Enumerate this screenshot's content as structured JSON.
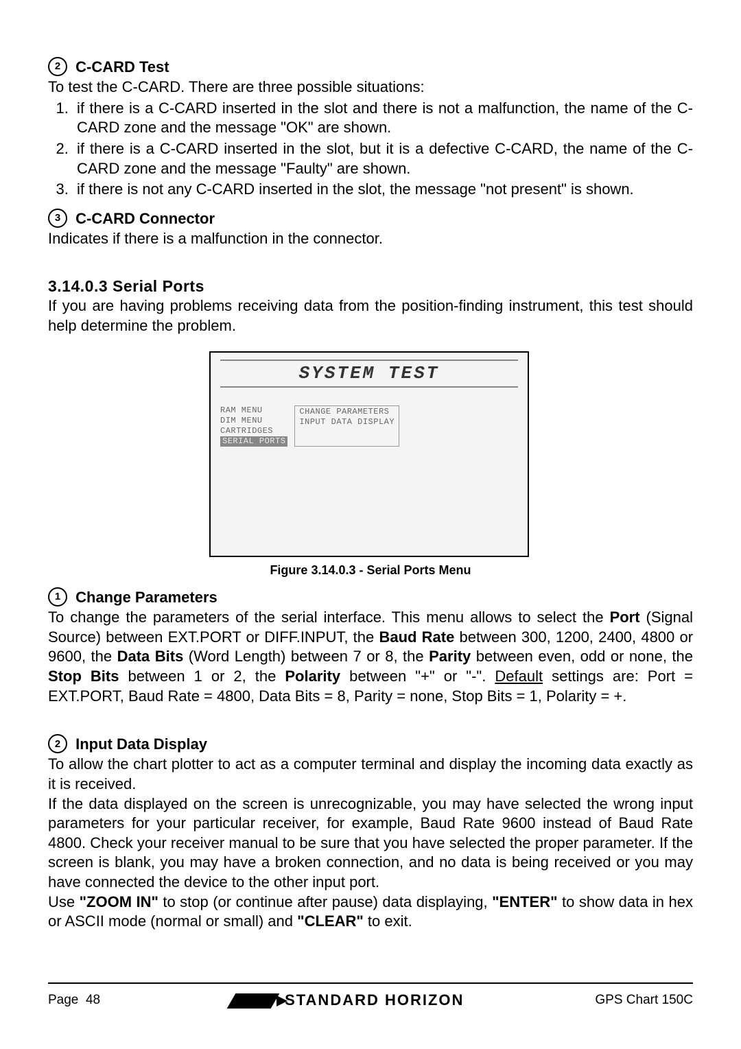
{
  "section2": {
    "num": "2",
    "title": "C-CARD Test",
    "intro": "To test the C-CARD. There are three possible situations:",
    "items": [
      "if there is a C-CARD inserted in the slot and there is not a malfunction, the name of the C-CARD zone and the message \"OK\" are shown.",
      "if there is a C-CARD inserted in the slot, but it is a defective C-CARD, the name of the C-CARD zone and the message \"Faulty\" are shown.",
      "if there is not any C-CARD inserted in the slot, the message \"not present\" is shown."
    ]
  },
  "section3": {
    "num": "3",
    "title": "C-CARD Connector",
    "text": "Indicates if there is a malfunction in the connector."
  },
  "serial": {
    "heading_num": "3.14.0.3",
    "heading_title": "Serial Ports",
    "intro": "If you are having problems receiving data from the position-finding instrument, this test should help determine the problem.",
    "screen_title": "SYSTEM TEST",
    "menu_left": [
      "RAM MENU",
      "DIM MENU",
      "CARTRIDGES",
      "SERIAL PORTS"
    ],
    "menu_right": [
      "CHANGE PARAMETERS",
      "INPUT DATA DISPLAY"
    ],
    "fig_caption": "Figure 3.14.0.3 - Serial Ports Menu"
  },
  "change_params": {
    "num": "1",
    "title": "Change Parameters",
    "p1_a": "To change the parameters of the serial interface. This menu allows to select the ",
    "b_port": "Port",
    "p1_b": " (Signal Source) between EXT.PORT or DIFF.INPUT, the ",
    "b_baud": "Baud Rate",
    "p1_c": " between 300, 1200, 2400, 4800 or 9600, the ",
    "b_data": "Data Bits",
    "p1_d": " (Word Length) between 7 or 8, the ",
    "b_parity": "Parity",
    "p1_e": " between even, odd or none, the ",
    "b_stop": "Stop Bits",
    "p1_f": " between 1 or 2, the ",
    "b_polarity": "Polarity",
    "p1_g": " between \"+\" or \"-\". ",
    "u_default": "Default",
    "p1_h": " settings are: Port = EXT.PORT, Baud Rate = 4800, Data Bits = 8, Parity = none, Stop Bits = 1, Polarity = +."
  },
  "input_disp": {
    "num": "2",
    "title": "Input Data Display",
    "p1": "To allow the chart plotter to act as a computer terminal and display the incoming data exactly as it is received.",
    "p2": "If the data displayed on the screen is unrecognizable, you may have selected the wrong input parameters for your particular receiver, for example, Baud Rate 9600 instead of Baud Rate 4800. Check your receiver manual to be sure that you have selected the proper parameter. If the screen is blank, you may have a broken connection, and no data is being received or you may have connected the device to the other input port.",
    "p3_a": "Use ",
    "b_zoom": "\"ZOOM IN\"",
    "p3_b": " to stop (or continue after pause) data displaying, ",
    "b_enter": "\"ENTER\"",
    "p3_c": " to show data in hex or ASCII mode (normal or small) and ",
    "b_clear": "\"CLEAR\"",
    "p3_d": " to exit."
  },
  "footer": {
    "page_label": "Page",
    "page_num": "48",
    "brand": "STANDARD HORIZON",
    "model": "GPS Chart 150C"
  }
}
